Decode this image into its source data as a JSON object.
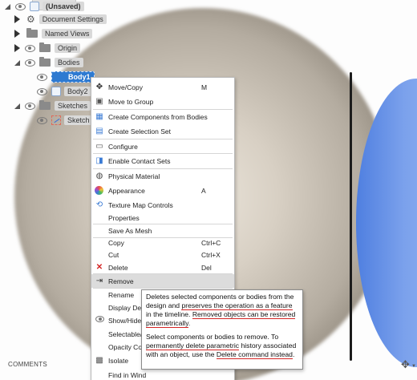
{
  "browser": {
    "document_name": "(Unsaved)",
    "items": {
      "document_settings": "Document Settings",
      "named_views": "Named Views",
      "origin": "Origin",
      "bodies": "Bodies",
      "body1": "Body1",
      "body2": "Body2",
      "sketches": "Sketches",
      "sketch": "Sketch"
    }
  },
  "context_menu": {
    "items": [
      {
        "label": "Move/Copy",
        "shortcut": "M",
        "icon": "move-icon"
      },
      {
        "label": "Move to Group",
        "shortcut": "",
        "icon": "group-icon"
      },
      {
        "label": "Create Components from Bodies",
        "shortcut": "",
        "icon": "component-icon"
      },
      {
        "label": "Create Selection Set",
        "shortcut": "",
        "icon": "selection-set-icon"
      },
      {
        "label": "Configure",
        "shortcut": "",
        "icon": "configure-icon"
      },
      {
        "label": "Enable Contact Sets",
        "shortcut": "",
        "icon": "contact-set-icon"
      },
      {
        "label": "Physical Material",
        "shortcut": "",
        "icon": "material-icon"
      },
      {
        "label": "Appearance",
        "shortcut": "A",
        "icon": "appearance-icon"
      },
      {
        "label": "Texture Map Controls",
        "shortcut": "",
        "icon": "texture-icon"
      },
      {
        "label": "Properties",
        "shortcut": "",
        "icon": ""
      },
      {
        "label": "Save As Mesh",
        "shortcut": "",
        "icon": ""
      },
      {
        "label": "Copy",
        "shortcut": "Ctrl+C",
        "icon": ""
      },
      {
        "label": "Cut",
        "shortcut": "Ctrl+X",
        "icon": ""
      },
      {
        "label": "Delete",
        "shortcut": "Del",
        "icon": "delete-icon"
      },
      {
        "label": "Remove",
        "shortcut": "",
        "icon": "remove-icon"
      },
      {
        "label": "Rename",
        "shortcut": "",
        "icon": ""
      },
      {
        "label": "Display Deta",
        "shortcut": "",
        "icon": ""
      },
      {
        "label": "Show/Hide",
        "shortcut": "",
        "icon": "eye-icon"
      },
      {
        "label": "Selectable/U",
        "shortcut": "",
        "icon": ""
      },
      {
        "label": "Opacity Con",
        "shortcut": "",
        "icon": ""
      },
      {
        "label": "Isolate",
        "shortcut": "",
        "icon": "isolate-icon"
      },
      {
        "label": "Find in Wind",
        "shortcut": "",
        "icon": ""
      }
    ]
  },
  "tooltip": {
    "p1_a": "Deletes selected components or bodies from the design and ",
    "p1_b": "preserves the operation as a feature",
    "p1_c": " in the timeline. ",
    "p1_d": "Removed objects can be restored parametrically",
    "p1_e": ".",
    "p2_a": "Select components or bodies to remove. To ",
    "p2_b": "permanently delete parametric",
    "p2_c": " history associated with an object, use the ",
    "p2_d": "Delete command instead",
    "p2_e": "."
  },
  "bottom": {
    "comments_label": "COMMENTS"
  },
  "colors": {
    "selection_blue": "#2e7ad1",
    "menu_highlight": "#dcdcdc",
    "annotation_red": "#d52424",
    "model_blue": "#6f96e8"
  }
}
